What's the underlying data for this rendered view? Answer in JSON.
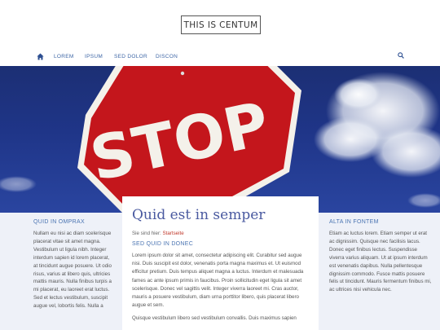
{
  "header": {
    "logo": "THIS IS CENTUM"
  },
  "nav": {
    "home_icon": "home-icon",
    "items": [
      "LOREM",
      "IPSUM",
      "SED DOLOR",
      "DISCON"
    ],
    "search_icon": "search-icon"
  },
  "hero": {
    "sign_text": "STOP"
  },
  "left": {
    "heading": "QUID IN OMPRAX",
    "text": "Nullam eu nisi ac diam scelerisque placerat vitae sit amet magna. Vestibulum ut ligula nibh. Integer interdum sapien id lorem placerat, at tincidunt augue posuere. Ut odio risus, varius at libero quis, ultricies mattis mauris. Nulla finibus turpis a mi placerat, eu laoreet erat luctus. Sed et lectus vestibulum, suscipit augue vel, lobortis felis. Nulla a"
  },
  "main": {
    "title": "Quid est in semper",
    "breadcrumb_prefix": "Sie sind hier:",
    "breadcrumb_link": "Startseite",
    "subheading": "SED QUID IN DONEC",
    "paragraph1": "Lorem ipsum dolor sit amet, consectetur adipiscing elit. Curabitur sed augue nisi. Duis suscipit est dolor, venenatis porta magna maximus et. Ut euismod efficitur pretium. Duis tempus aliquet magna a luctus. Interdum et malesuada fames ac ante ipsum primis in faucibus. Proin sollicitudin eget ligula sit amet scelerisque. Donec vel sagittis velit. Integer viverra laoreet mi. Cras auctor, mauris a posuere vestibulum, diam urna porttitor libero, quis placerat libero augue et sem.",
    "paragraph2": "Quisque vestibulum libero sed vestibulum convallis. Duis maximus sapien"
  },
  "right": {
    "heading": "ALTA IN FONTEM",
    "text": "Etiam ac luctus lorem. Etiam semper ut erat ac dignissim. Quisque nec facilisis lacus. Donec eget finibus lectus. Suspendisse viverra varius aliquam. Ut at ipsum interdum est venenatis dapibus. Nulla pellentesque dignissim commodo. Fusce mattis posuere felis ut tincidunt. Mauris fermentum finibus mi, ac ultrices nisi vehicula nec."
  },
  "colors": {
    "accent": "#4a74b2",
    "link": "#c0392b",
    "title": "#4a5aa0",
    "side_bg": "#eef1f8",
    "sign_red": "#c4161c"
  }
}
